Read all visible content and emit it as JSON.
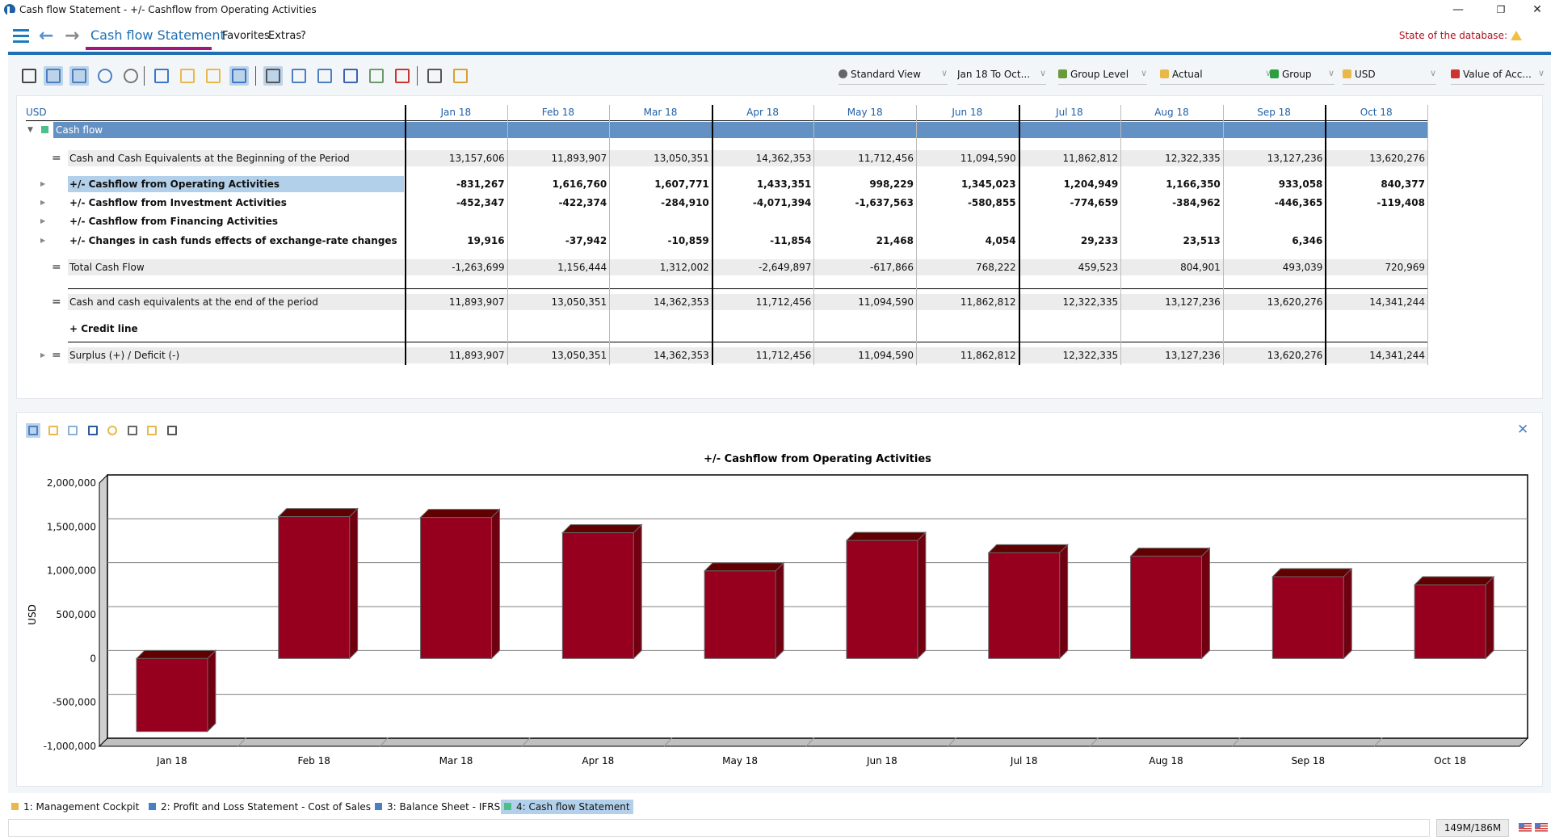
{
  "window": {
    "title": "Cash flow Statement - +/- Cashflow from Operating Activities",
    "controls": {
      "minimize": "—",
      "restore": "❐",
      "close": "✕"
    }
  },
  "nav": {
    "title": "Cash flow Statement",
    "menu": [
      "Favorites",
      "Extras",
      "?"
    ],
    "db_state_label": "State of the database:"
  },
  "toolbar": {
    "icons": [
      "print-icon",
      "layout-table-icon",
      "layout-chart-icon",
      "help-icon",
      "search-icon",
      "open-folder-icon",
      "upload-folder-icon",
      "folder-settings-icon",
      "folder-search-icon",
      "grid-view-1-icon",
      "grid-view-2-icon",
      "grid-view-3-icon",
      "grid-view-4-icon",
      "grid-view-5-icon",
      "grid-view-6-icon",
      "settings-icon",
      "balance-icon"
    ],
    "dropdowns": [
      {
        "label": "Standard View",
        "icon": "gear"
      },
      {
        "label": "Jan 18 To Oct...",
        "icon": ""
      },
      {
        "label": "Group Level",
        "icon": "hierarchy"
      },
      {
        "label": "Actual",
        "icon": "cube"
      },
      {
        "label": "Group",
        "icon": "play"
      },
      {
        "label": "USD",
        "icon": "coins"
      },
      {
        "label": "Value of Acc...",
        "icon": "lock"
      }
    ]
  },
  "table": {
    "currency": "USD",
    "months": [
      "Jan 18",
      "Feb 18",
      "Mar 18",
      "Apr 18",
      "May 18",
      "Jun 18",
      "Jul 18",
      "Aug 18",
      "Sep 18",
      "Oct 18"
    ],
    "group_label": "Cash flow",
    "rows": [
      {
        "prefix": "=",
        "label": "Cash and Cash Equivalents at the Beginning of the Period",
        "bold": false,
        "shaded": true,
        "expand": false,
        "values": [
          "13,157,606",
          "11,893,907",
          "13,050,351",
          "14,362,353",
          "11,712,456",
          "11,094,590",
          "11,862,812",
          "12,322,335",
          "13,127,236",
          "13,620,276"
        ]
      },
      {
        "prefix": "",
        "label": "+/- Cashflow from Operating Activities",
        "bold": true,
        "shaded": false,
        "expand": true,
        "selected": true,
        "values": [
          "-831,267",
          "1,616,760",
          "1,607,771",
          "1,433,351",
          "998,229",
          "1,345,023",
          "1,204,949",
          "1,166,350",
          "933,058",
          "840,377"
        ]
      },
      {
        "prefix": "",
        "label": "+/- Cashflow from Investment Activities",
        "bold": true,
        "shaded": false,
        "expand": true,
        "values": [
          "-452,347",
          "-422,374",
          "-284,910",
          "-4,071,394",
          "-1,637,563",
          "-580,855",
          "-774,659",
          "-384,962",
          "-446,365",
          "-119,408"
        ]
      },
      {
        "prefix": "",
        "label": "+/- Cashflow from Financing Activities",
        "bold": true,
        "shaded": false,
        "expand": true,
        "values": [
          "",
          "",
          "",
          "",
          "",
          "",
          "",
          "",
          "",
          ""
        ]
      },
      {
        "prefix": "",
        "label": "+/- Changes in cash funds effects of exchange-rate changes",
        "bold": true,
        "shaded": false,
        "expand": true,
        "values": [
          "19,916",
          "-37,942",
          "-10,859",
          "-11,854",
          "21,468",
          "4,054",
          "29,233",
          "23,513",
          "6,346",
          ""
        ]
      },
      {
        "prefix": "=",
        "label": "Total Cash Flow",
        "bold": false,
        "shaded": true,
        "expand": false,
        "values": [
          "-1,263,699",
          "1,156,444",
          "1,312,002",
          "-2,649,897",
          "-617,866",
          "768,222",
          "459,523",
          "804,901",
          "493,039",
          "720,969"
        ]
      },
      {
        "prefix": "=",
        "label": "Cash and cash equivalents at the end of the period",
        "bold": false,
        "shaded": true,
        "expand": false,
        "values": [
          "11,893,907",
          "13,050,351",
          "14,362,353",
          "11,712,456",
          "11,094,590",
          "11,862,812",
          "12,322,335",
          "13,127,236",
          "13,620,276",
          "14,341,244"
        ]
      },
      {
        "prefix": "",
        "label": "+ Credit line",
        "bold": true,
        "shaded": false,
        "expand": false,
        "values": [
          "",
          "",
          "",
          "",
          "",
          "",
          "",
          "",
          "",
          ""
        ]
      },
      {
        "prefix": "=",
        "label": "Surplus (+) / Deficit (-)",
        "bold": false,
        "shaded": true,
        "expand": true,
        "values": [
          "11,893,907",
          "13,050,351",
          "14,362,353",
          "11,712,456",
          "11,094,590",
          "11,862,812",
          "12,322,335",
          "13,127,236",
          "13,620,276",
          "14,341,244"
        ]
      }
    ]
  },
  "chart_toolbar": {
    "icons": [
      "bar-chart-icon",
      "stacked-bar-icon",
      "line-chart-icon",
      "area-chart-icon",
      "pie-chart-icon",
      "chart-settings-icon",
      "new-window-icon",
      "print-icon"
    ],
    "close": "✕"
  },
  "chart_data": {
    "type": "bar",
    "title": "+/- Cashflow from Operating Activities",
    "xlabel": "",
    "ylabel": "USD",
    "categories": [
      "Jan 18",
      "Feb 18",
      "Mar 18",
      "Apr 18",
      "May 18",
      "Jun 18",
      "Jul 18",
      "Aug 18",
      "Sep 18",
      "Oct 18"
    ],
    "values": [
      -831267,
      1616760,
      1607771,
      1433351,
      998229,
      1345023,
      1204949,
      1166350,
      933058,
      840377
    ],
    "ylim": [
      -1000000,
      2000000
    ],
    "yticks": [
      -1000000,
      -500000,
      0,
      500000,
      1000000,
      1500000,
      2000000
    ],
    "ytick_labels": [
      "-1,000,000",
      "-500,000",
      "0",
      "500,000",
      "1,000,000",
      "1,500,000",
      "2,000,000"
    ],
    "grid": true,
    "style": "3d",
    "color": "#96001e",
    "legend": "none"
  },
  "bottom_tabs": [
    {
      "label": "1: Management Cockpit",
      "color": "#e8b84a",
      "active": false
    },
    {
      "label": "2: Profit and Loss Statement - Cost of Sales",
      "color": "#4a7fc1",
      "active": false
    },
    {
      "label": "3: Balance Sheet - IFRS",
      "color": "#4a7fc1",
      "active": false
    },
    {
      "label": "4: Cash flow Statement",
      "color": "#4fbf8a",
      "active": true
    }
  ],
  "status": {
    "memory": "149M/186M"
  }
}
